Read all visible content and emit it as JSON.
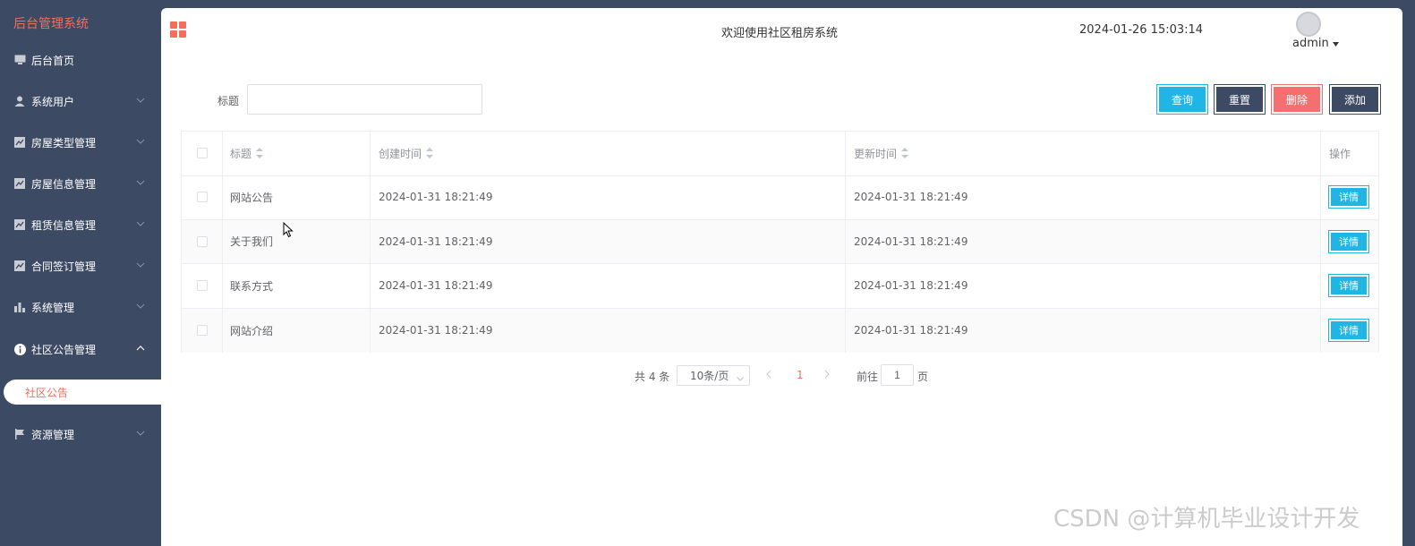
{
  "app": {
    "brand": "后台管理系统",
    "welcome": "欢迎使用社区租房系统",
    "datetime": "2024-01-26 15:03:14",
    "user": "admin"
  },
  "sidebar": {
    "items": [
      {
        "label": "后台首页",
        "icon": "monitor-icon"
      },
      {
        "label": "系统用户",
        "icon": "user-icon"
      },
      {
        "label": "房屋类型管理",
        "icon": "chart-icon"
      },
      {
        "label": "房屋信息管理",
        "icon": "chart-icon"
      },
      {
        "label": "租赁信息管理",
        "icon": "chart-icon"
      },
      {
        "label": "合同签订管理",
        "icon": "chart-icon"
      },
      {
        "label": "系统管理",
        "icon": "bar-chart-icon"
      },
      {
        "label": "社区公告管理",
        "icon": "info-icon"
      },
      {
        "label": "资源管理",
        "icon": "flag-icon"
      }
    ],
    "submenu": {
      "label": "社区公告"
    }
  },
  "search": {
    "label": "标题",
    "value": "",
    "buttons": {
      "query": "查询",
      "reset": "重置",
      "delete": "删除",
      "add": "添加"
    }
  },
  "table": {
    "headers": {
      "title": "标题",
      "created": "创建时间",
      "updated": "更新时间",
      "op": "操作"
    },
    "rows": [
      {
        "title": "网站公告",
        "created": "2024-01-31 18:21:49",
        "updated": "2024-01-31 18:21:49",
        "action": "详情"
      },
      {
        "title": "关于我们",
        "created": "2024-01-31 18:21:49",
        "updated": "2024-01-31 18:21:49",
        "action": "详情"
      },
      {
        "title": "联系方式",
        "created": "2024-01-31 18:21:49",
        "updated": "2024-01-31 18:21:49",
        "action": "详情"
      },
      {
        "title": "网站介绍",
        "created": "2024-01-31 18:21:49",
        "updated": "2024-01-31 18:21:49",
        "action": "详情"
      }
    ]
  },
  "pagination": {
    "total": "共 4 条",
    "page_size": "10条/页",
    "current": "1",
    "goto_label": "前往",
    "goto_value": "1",
    "page_suffix": "页"
  },
  "watermark": "CSDN @计算机毕业设计开发",
  "colors": {
    "sidebar_bg": "#3d4a64",
    "accent": "#f46e5c",
    "query": "#1fb6e6",
    "delete": "#f36f70"
  }
}
